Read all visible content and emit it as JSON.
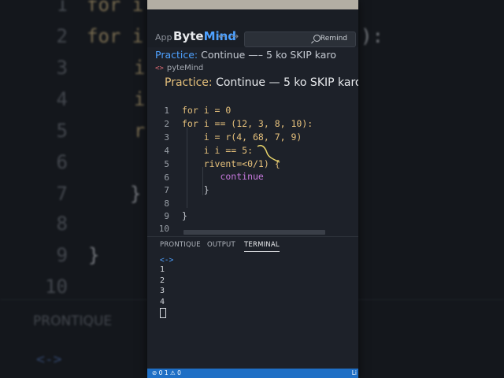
{
  "background": {
    "line_numbers": [
      "1",
      "2",
      "3",
      "4",
      "5",
      "6",
      "7",
      "8",
      "9",
      "10"
    ],
    "code_fragments": [
      "for i",
      "for i",
      "i",
      "i",
      "r",
      "",
      "}",
      "",
      "}",
      ""
    ],
    "fragment_right": "):",
    "panel_label": "PRONTIQUE",
    "prompt": "<->"
  },
  "titlebar": {
    "app_label": "App",
    "brand_main": "Byte",
    "brand_accent": "Mind",
    "search_label": "Remind"
  },
  "tab": {
    "prefix": "Practice:",
    "title": "Continue —– 5 ko SKIP karo"
  },
  "file": {
    "icon": "<>",
    "name": "pyteMind"
  },
  "heading": {
    "prefix": "Practice:",
    "title": "Continue — 5 ko SKIP karo"
  },
  "editor": {
    "line_numbers": [
      "1",
      "2",
      "3",
      "4",
      "5",
      "6",
      "7",
      "8",
      "9",
      "10"
    ],
    "lines": [
      "for i = 0",
      "for i == (12, 3, 8, 10):",
      "    i = r(4, 68, 7, 9)",
      "    i i == 5:",
      "    rivent=<0/1) {",
      "       continue",
      "    }",
      "",
      "}",
      ""
    ]
  },
  "panel": {
    "tabs": [
      "PRONTIQUE",
      "OUTPUT",
      "TERMINAL"
    ],
    "active_tab": "TERMINAL",
    "prompt": "<->",
    "output": [
      "1",
      "2",
      "3",
      "4"
    ]
  },
  "status": {
    "left": "⊘ 0 1 ⚠ 0",
    "right": "Li"
  },
  "colors": {
    "accent_blue": "#4ea1ff",
    "keyword_yellow": "#e5c07b",
    "keyword_purple": "#c678dd",
    "statusbar": "#1f6fc5"
  }
}
